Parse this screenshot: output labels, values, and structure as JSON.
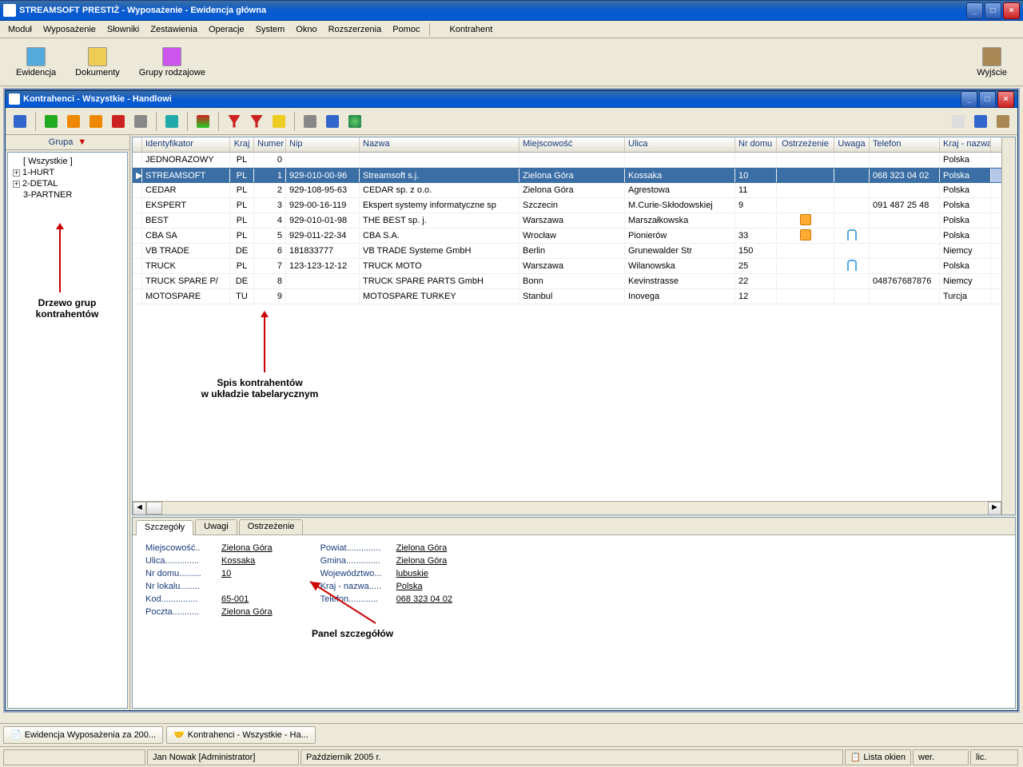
{
  "app_title": "STREAMSOFT PRESTIŻ - Wyposażenie - Ewidencja główna",
  "menu": [
    "Moduł",
    "Wyposażenie",
    "Słowniki",
    "Zestawienia",
    "Operacje",
    "System",
    "Okno",
    "Rozszerzenia",
    "Pomoc"
  ],
  "menu_right": "Kontrahent",
  "bigbtns": [
    {
      "name": "ewidencja",
      "label": "Ewidencja"
    },
    {
      "name": "dokumenty",
      "label": "Dokumenty"
    },
    {
      "name": "grupy",
      "label": "Grupy rodzajowe"
    }
  ],
  "exit_label": "Wyjście",
  "child_title": "Kontrahenci - Wszystkie - Handlowi",
  "tree_header": "Grupa",
  "tree_items": [
    {
      "label": "[ Wszystkie ]",
      "plus": false
    },
    {
      "label": "1-HURT",
      "plus": true
    },
    {
      "label": "2-DETAL",
      "plus": true
    },
    {
      "label": "3-PARTNER",
      "plus": false
    }
  ],
  "columns": [
    "Identyfikator",
    "Kraj",
    "Numer",
    "Nip",
    "Nazwa",
    "Miejscowość",
    "Ulica",
    "Nr domu",
    "Ostrzeżenie",
    "Uwaga",
    "Telefon",
    "Kraj - nazwa"
  ],
  "rows": [
    {
      "id": "JEDNORAZOWY",
      "kraj": "PL",
      "num": "0",
      "nip": "",
      "nazwa": "",
      "mie": "",
      "uli": "",
      "dom": "",
      "ostr": "",
      "uwaga": "",
      "tel": "",
      "krajn": "Polska",
      "sel": false
    },
    {
      "id": "STREAMSOFT",
      "kraj": "PL",
      "num": "1",
      "nip": "929-010-00-96",
      "nazwa": "Streamsoft s.j.",
      "mie": "Zielona Góra",
      "uli": "Kossaka",
      "dom": "10",
      "ostr": "",
      "uwaga": "",
      "tel": "068 323 04 02",
      "krajn": "Polska",
      "sel": true
    },
    {
      "id": "CEDAR",
      "kraj": "PL",
      "num": "2",
      "nip": "929-108-95-63",
      "nazwa": "CEDAR sp. z o.o.",
      "mie": "Zielona Góra",
      "uli": "Agrestowa",
      "dom": "11",
      "ostr": "",
      "uwaga": "",
      "tel": "",
      "krajn": "Polska",
      "sel": false
    },
    {
      "id": "EKSPERT",
      "kraj": "PL",
      "num": "3",
      "nip": "929-00-16-119",
      "nazwa": "Ekspert systemy informatyczne sp",
      "mie": "Szczecin",
      "uli": "M.Curie-Skłodowskiej",
      "dom": "9",
      "ostr": "",
      "uwaga": "",
      "tel": "091 487 25 48",
      "krajn": "Polska",
      "sel": false
    },
    {
      "id": "BEST",
      "kraj": "PL",
      "num": "4",
      "nip": "929-010-01-98",
      "nazwa": "THE BEST sp. j.",
      "mie": "Warszawa",
      "uli": "Marszałkowska",
      "dom": "",
      "ostr": "warn",
      "uwaga": "",
      "tel": "",
      "krajn": "Polska",
      "sel": false
    },
    {
      "id": "CBA SA",
      "kraj": "PL",
      "num": "5",
      "nip": "929-011-22-34",
      "nazwa": "CBA S.A.",
      "mie": "Wrocław",
      "uli": "Pionierów",
      "dom": "33",
      "ostr": "warn",
      "uwaga": "clip",
      "tel": "",
      "krajn": "Polska",
      "sel": false
    },
    {
      "id": "VB TRADE",
      "kraj": "DE",
      "num": "6",
      "nip": "181833777",
      "nazwa": "VB TRADE Systeme GmbH",
      "mie": "Berlin",
      "uli": "Grunewalder Str",
      "dom": "150",
      "ostr": "",
      "uwaga": "",
      "tel": "",
      "krajn": "Niemcy",
      "sel": false
    },
    {
      "id": "TRUCK",
      "kraj": "PL",
      "num": "7",
      "nip": "123-123-12-12",
      "nazwa": "TRUCK MOTO",
      "mie": "Warszawa",
      "uli": "Wilanowska",
      "dom": "25",
      "ostr": "",
      "uwaga": "clip",
      "tel": "",
      "krajn": "Polska",
      "sel": false
    },
    {
      "id": "TRUCK SPARE P/",
      "kraj": "DE",
      "num": "8",
      "nip": "",
      "nazwa": "TRUCK SPARE PARTS GmbH",
      "mie": "Bonn",
      "uli": "Kevinstrasse",
      "dom": "22",
      "ostr": "",
      "uwaga": "",
      "tel": "048767687876",
      "krajn": "Niemcy",
      "sel": false
    },
    {
      "id": "MOTOSPARE",
      "kraj": "TU",
      "num": "9",
      "nip": "",
      "nazwa": "MOTOSPARE TURKEY",
      "mie": "Stanbul",
      "uli": "Inovega",
      "dom": "12",
      "ostr": "",
      "uwaga": "",
      "tel": "",
      "krajn": "Turcja",
      "sel": false
    }
  ],
  "tabs": [
    "Szczegóły",
    "Uwagi",
    "Ostrzeżenie"
  ],
  "details_left": [
    {
      "label": "Miejscowość..",
      "val": "Zielona Góra"
    },
    {
      "label": "Ulica..............",
      "val": "Kossaka"
    },
    {
      "label": "Nr domu.........",
      "val": "10"
    },
    {
      "label": "Nr lokalu........",
      "val": ""
    },
    {
      "label": "Kod...............",
      "val": "65-001"
    },
    {
      "label": "Poczta...........",
      "val": "Zielona Góra"
    }
  ],
  "details_right": [
    {
      "label": "Powiat..............",
      "val": "Zielona Góra"
    },
    {
      "label": "Gmina..............",
      "val": "Zielona Góra"
    },
    {
      "label": "Województwo...",
      "val": "lubuskie"
    },
    {
      "label": "Kraj - nazwa.....",
      "val": "Polska"
    },
    {
      "label": "Telefon............",
      "val": "068 323 04 02"
    }
  ],
  "taskbar": [
    "Ewidencja Wyposażenia za 200...",
    "Kontrahenci - Wszystkie - Ha..."
  ],
  "status": {
    "user": "Jan Nowak [Administrator]",
    "period": "Październik 2005 r.",
    "lista": "Lista okien",
    "wer": "wer.",
    "lic": "lic."
  },
  "annotations": {
    "tree": "Drzewo grup\nkontrahentów",
    "table": "Spis kontrahentów\nw układzie tabelarycznym",
    "detail": "Panel szczegółów"
  }
}
